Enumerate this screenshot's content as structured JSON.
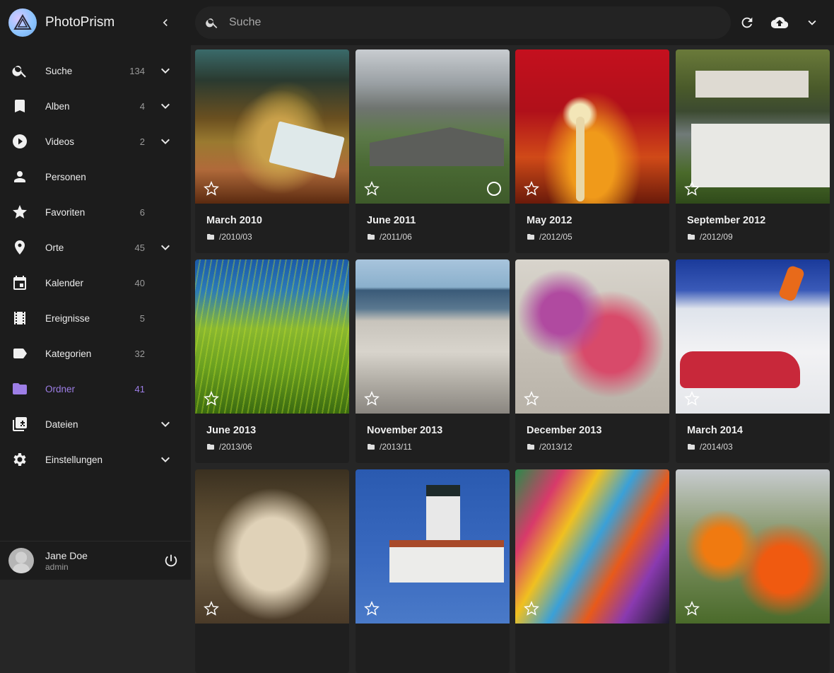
{
  "app": {
    "title": "PhotoPrism"
  },
  "sidebar": {
    "items": [
      {
        "label": "Suche",
        "count": "134",
        "icon": "search-icon",
        "expand": true
      },
      {
        "label": "Alben",
        "count": "4",
        "icon": "bookmark-icon",
        "expand": true
      },
      {
        "label": "Videos",
        "count": "2",
        "icon": "play-circle-icon",
        "expand": true
      },
      {
        "label": "Personen",
        "count": "",
        "icon": "person-icon",
        "expand": false
      },
      {
        "label": "Favoriten",
        "count": "6",
        "icon": "star-icon",
        "expand": false
      },
      {
        "label": "Orte",
        "count": "45",
        "icon": "place-icon",
        "expand": true
      },
      {
        "label": "Kalender",
        "count": "40",
        "icon": "calendar-icon",
        "expand": false
      },
      {
        "label": "Ereignisse",
        "count": "5",
        "icon": "film-icon",
        "expand": false
      },
      {
        "label": "Kategorien",
        "count": "32",
        "icon": "label-icon",
        "expand": false
      },
      {
        "label": "Ordner",
        "count": "41",
        "icon": "folder-icon",
        "expand": false,
        "active": true
      },
      {
        "label": "Dateien",
        "count": "",
        "icon": "files-icon",
        "expand": true
      },
      {
        "label": "Einstellungen",
        "count": "",
        "icon": "gear-icon",
        "expand": true
      }
    ]
  },
  "user": {
    "name": "Jane Doe",
    "role": "admin"
  },
  "search": {
    "placeholder": "Suche"
  },
  "colors": {
    "accent": "#9d7ee6",
    "sidebar_bg": "#1c1c1c",
    "content_bg": "#262626",
    "card_bg": "#1f1f1f"
  },
  "folders": [
    {
      "title": "March 2010",
      "path": "/2010/03"
    },
    {
      "title": "June 2011",
      "path": "/2011/06"
    },
    {
      "title": "May 2012",
      "path": "/2012/05"
    },
    {
      "title": "September 2012",
      "path": "/2012/09"
    },
    {
      "title": "June 2013",
      "path": "/2013/06"
    },
    {
      "title": "November 2013",
      "path": "/2013/11"
    },
    {
      "title": "December 2013",
      "path": "/2013/12"
    },
    {
      "title": "March 2014",
      "path": "/2014/03"
    },
    {
      "title": "",
      "path": ""
    },
    {
      "title": "",
      "path": ""
    },
    {
      "title": "",
      "path": ""
    },
    {
      "title": "",
      "path": ""
    }
  ]
}
